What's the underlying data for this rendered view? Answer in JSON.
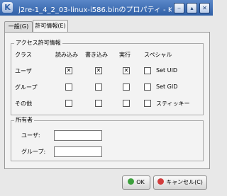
{
  "window": {
    "title": "j2re-1_4_2_03-linux-i586.binのプロパティ - Konque",
    "app_icon": "konqueror-icon",
    "buttons": {
      "minimize": "⎯",
      "maximize": "▴",
      "close": "✕"
    }
  },
  "tabs": [
    {
      "label": "一般(G)",
      "active": false
    },
    {
      "label": "許可情報(E)",
      "active": true
    }
  ],
  "access": {
    "title": "アクセス許可情報",
    "headers": [
      "クラス",
      "読み込み",
      "書き込み",
      "実行",
      "スペシャル"
    ],
    "rows": [
      {
        "label": "ユーザ",
        "read": true,
        "write": true,
        "exec": true,
        "special_label": "Set UID",
        "special": false
      },
      {
        "label": "グループ",
        "read": false,
        "write": false,
        "exec": false,
        "special_label": "Set GID",
        "special": false
      },
      {
        "label": "その他",
        "read": false,
        "write": false,
        "exec": false,
        "special_label": "スティッキー",
        "special": false
      }
    ]
  },
  "owner": {
    "title": "所有者",
    "user_label": "ユーザ:",
    "user_value": "",
    "group_label": "グループ:",
    "group_value": ""
  },
  "footer": {
    "ok_label": "OK",
    "cancel_label": "キャンセル(C)"
  }
}
